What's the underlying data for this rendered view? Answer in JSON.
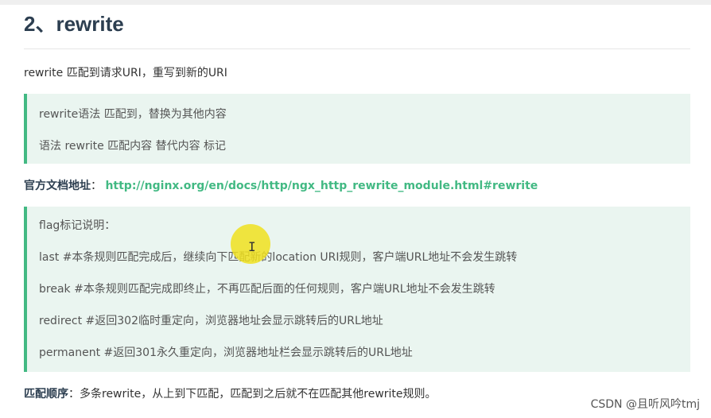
{
  "heading": "2、rewrite",
  "intro": "rewrite  匹配到请求URI，重写到新的URI",
  "tip1": {
    "lines": [
      "rewrite语法 匹配到，替换为其他内容",
      "语法  rewrite 匹配内容 替代内容  标记"
    ]
  },
  "docs": {
    "label": "官方文档地址",
    "separator": "：",
    "url": "http://nginx.org/en/docs/http/ngx_http_rewrite_module.html#rewrite"
  },
  "tip2": {
    "lines": [
      "flag标记说明：",
      "last  #本条规则匹配完成后，继续向下匹配新的location URI规则，客户端URL地址不会发生跳转",
      "break  #本条规则匹配完成即终止，不再匹配后面的任何规则，客户端URL地址不会发生跳转",
      "redirect  #返回302临时重定向，浏览器地址会显示跳转后的URL地址",
      "permanent  #返回301永久重定向，浏览器地址栏会显示跳转后的URL地址"
    ]
  },
  "match_order": {
    "label": "匹配顺序",
    "separator": "：",
    "text": "多条rewrite，从上到下匹配，匹配到之后就不在匹配其他rewrite规则。"
  },
  "watermark": "CSDN @且听风吟tmj",
  "colors": {
    "accent": "#42b983",
    "tip_bg": "#eaf5f0",
    "heading": "#2c3e50",
    "cursor_highlight": "#f0e11e"
  },
  "cursor_icon": "text-cursor-icon"
}
